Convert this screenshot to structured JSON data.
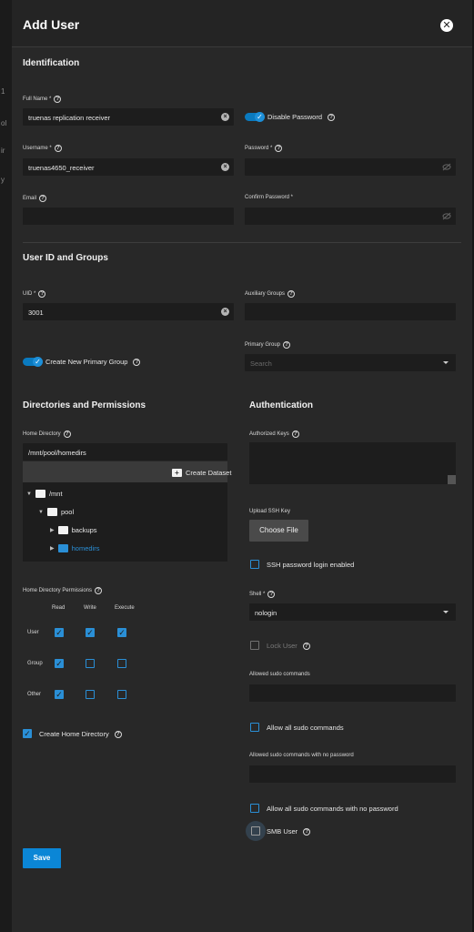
{
  "edge_fragments": [
    "1",
    "ol",
    "ir",
    "y"
  ],
  "dialog": {
    "title": "Add User",
    "close_icon": "close-icon"
  },
  "identification": {
    "heading": "Identification",
    "full_name_label": "Full Name *",
    "full_name_value": "truenas replication receiver",
    "disable_password_label": "Disable Password",
    "disable_password_on": true,
    "username_label": "Username *",
    "username_value": "truenas4650_receiver",
    "password_label": "Password *",
    "password_value": "",
    "email_label": "Email",
    "email_value": "",
    "confirm_password_label": "Confirm Password *",
    "confirm_password_value": ""
  },
  "user_id_groups": {
    "heading": "User ID and Groups",
    "uid_label": "UID *",
    "uid_value": "3001",
    "aux_groups_label": "Auxiliary Groups",
    "aux_groups_value": "",
    "create_primary_group_label": "Create New Primary Group",
    "create_primary_group_on": true,
    "primary_group_label": "Primary Group",
    "primary_group_placeholder": "Search"
  },
  "directories": {
    "heading": "Directories and Permissions",
    "home_directory_label": "Home Directory",
    "home_directory_value": "/mnt/pool/homedirs",
    "create_dataset_label": "Create Dataset",
    "tree": [
      {
        "name": "/mnt",
        "selected": false
      },
      {
        "name": "pool",
        "selected": false
      },
      {
        "name": "backups",
        "selected": false
      },
      {
        "name": "homedirs",
        "selected": true
      }
    ],
    "permissions_label": "Home Directory Permissions",
    "columns": [
      "Read",
      "Write",
      "Execute"
    ],
    "rows": [
      {
        "name": "User",
        "read": true,
        "write": true,
        "execute": true
      },
      {
        "name": "Group",
        "read": true,
        "write": false,
        "execute": false
      },
      {
        "name": "Other",
        "read": true,
        "write": false,
        "execute": false
      }
    ],
    "create_home_label": "Create Home Directory",
    "create_home_on": true
  },
  "authentication": {
    "heading": "Authentication",
    "authorized_keys_label": "Authorized Keys",
    "authorized_keys_value": "",
    "upload_ssh_label": "Upload SSH Key",
    "choose_file_label": "Choose File",
    "ssh_password_label": "SSH password login enabled",
    "shell_label": "Shell *",
    "shell_value": "nologin",
    "lock_user_label": "Lock User",
    "allowed_sudo_label": "Allowed sudo commands",
    "allow_all_sudo_label": "Allow all sudo commands",
    "allowed_sudo_nopass_label": "Allowed sudo commands with no password",
    "allow_all_sudo_nopass_label": "Allow all sudo commands with no password",
    "smb_user_label": "SMB User"
  },
  "actions": {
    "save_label": "Save"
  },
  "colors": {
    "accent": "#0b86d6",
    "panel": "#282828",
    "field": "#1d1d1d"
  }
}
